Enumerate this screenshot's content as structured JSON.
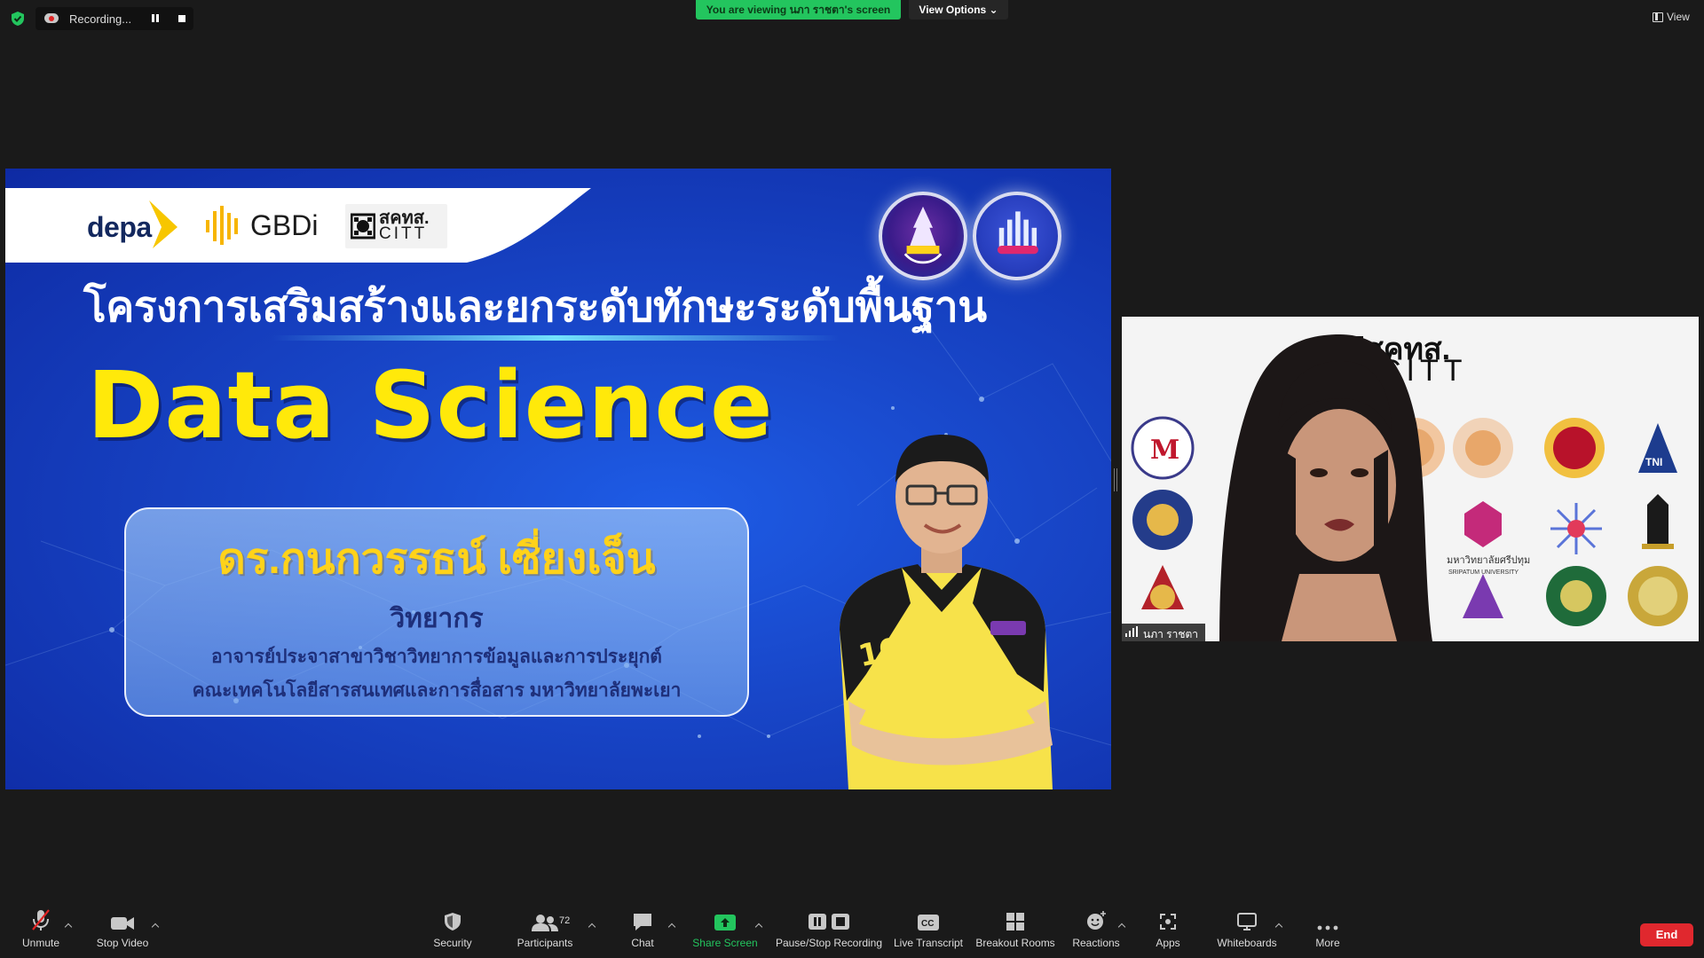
{
  "window": {
    "recording_label": "Recording...",
    "viewing_banner": "You are viewing นภา ราชตา's screen",
    "view_options_label": "View Options ⌄",
    "view_label": "View"
  },
  "slide": {
    "logo_depa": "depa",
    "logo_gbdi": "GBDi",
    "logo_citt_th": "สคทส.",
    "logo_citt_en": "CITT",
    "title_th": "โครงการเสริมสร้างและยกระดับทักษะระดับพื้นฐาน",
    "title_en": "Data Science",
    "speaker_name": "ดร.กนกวรรธน์ เซี่ยงเจ็น",
    "speaker_role": "วิทยากร",
    "speaker_desc_1": "อาจารย์ประจาสาขาวิชาวิทยาการข้อมูลและการประยุกต์",
    "speaker_desc_2": "คณะเทคโนโลยีสารสนเทศและการสื่อสาร มหาวิทยาลัยพะเยา",
    "shirt_number": "10"
  },
  "video": {
    "background_logo_th": "สคทส.",
    "background_logo_en": "CITT",
    "participant_name": "นภา ราชตา",
    "university_caption": "มหาวิทยาลัยศรีปทุม",
    "university_caption_en": "SRIPATUM UNIVERSITY",
    "tni_label": "TNI"
  },
  "toolbar": {
    "unmute": "Unmute",
    "stop_video": "Stop Video",
    "security": "Security",
    "participants": "Participants",
    "participants_count": "72",
    "chat": "Chat",
    "share_screen": "Share Screen",
    "pause_stop_recording": "Pause/Stop Recording",
    "live_transcript": "Live Transcript",
    "breakout_rooms": "Breakout Rooms",
    "reactions": "Reactions",
    "apps": "Apps",
    "whiteboards": "Whiteboards",
    "more": "More",
    "end": "End",
    "cc_label": "CC"
  },
  "colors": {
    "accent_green": "#23c55e",
    "end_red": "#e0282e",
    "slide_blue": "#1846c8",
    "title_yellow": "#ffe90a"
  }
}
